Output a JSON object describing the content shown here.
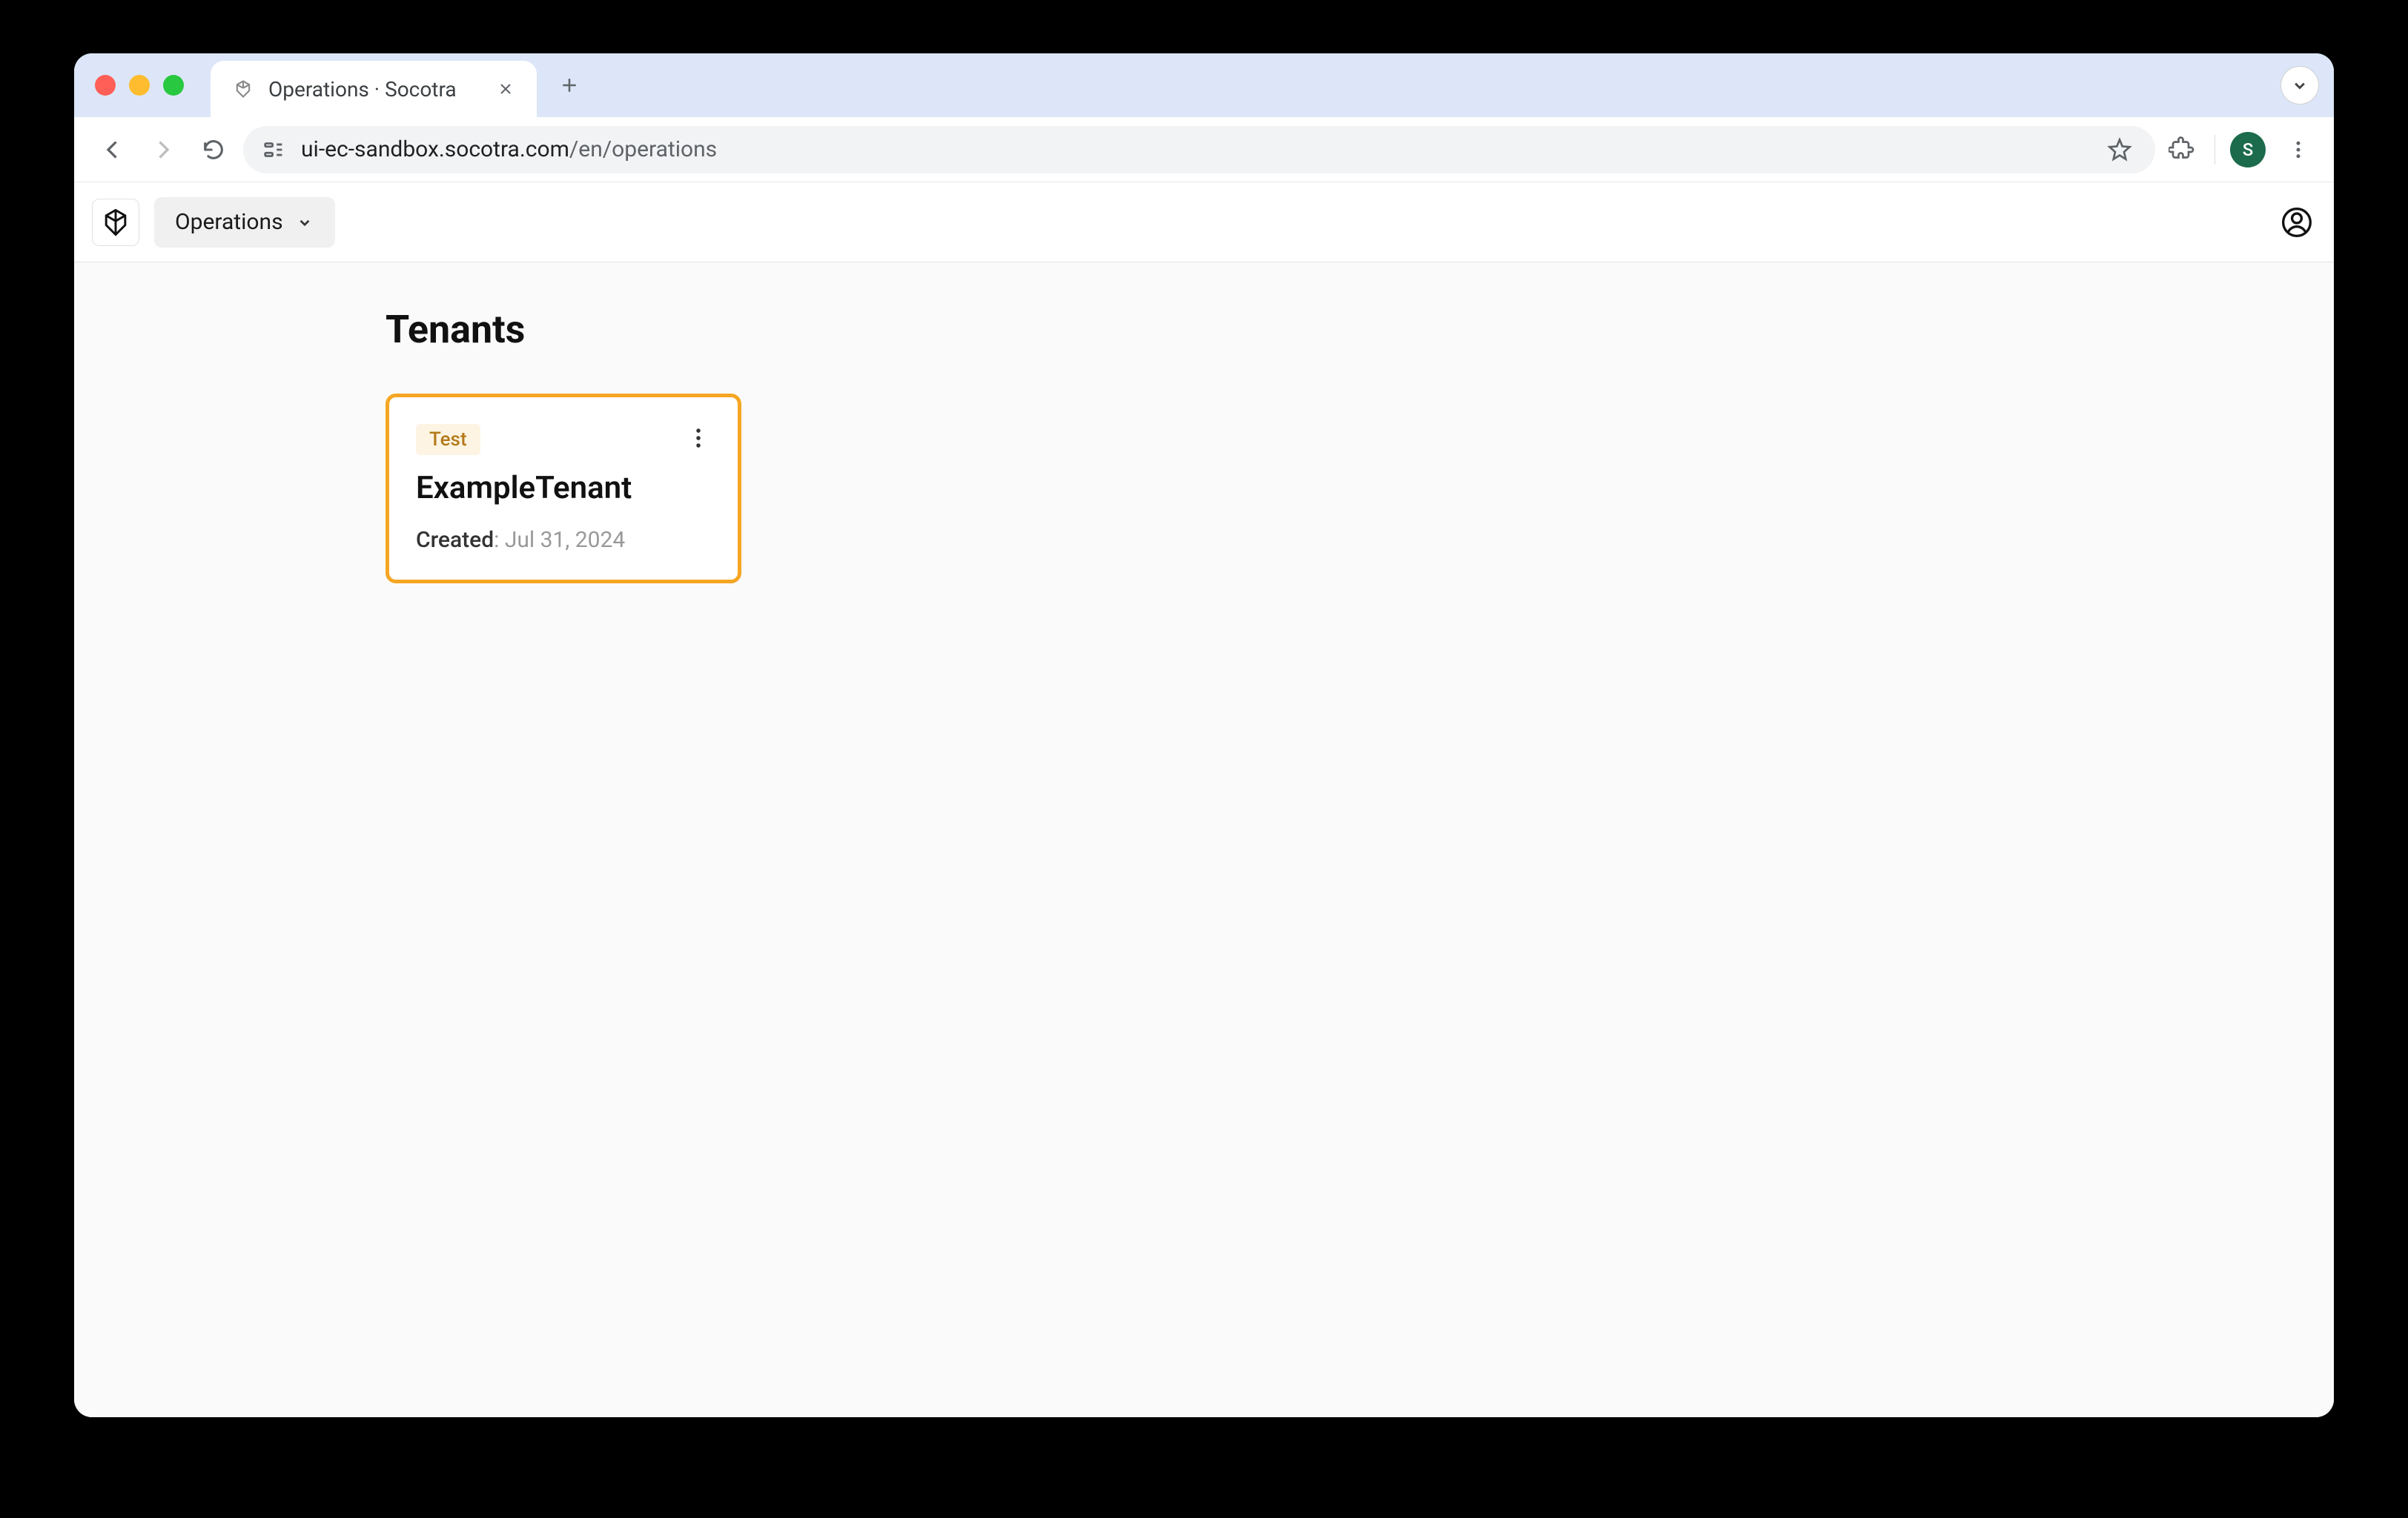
{
  "browser": {
    "tab_title": "Operations · Socotra",
    "url_domain": "ui-ec-sandbox.socotra.com",
    "url_path": "/en/operations",
    "profile_initial": "S"
  },
  "app": {
    "nav_label": "Operations"
  },
  "page": {
    "title": "Tenants"
  },
  "tenants": [
    {
      "badge": "Test",
      "name": "ExampleTenant",
      "created_label": "Created",
      "created_date": "Jul 31, 2024"
    }
  ]
}
